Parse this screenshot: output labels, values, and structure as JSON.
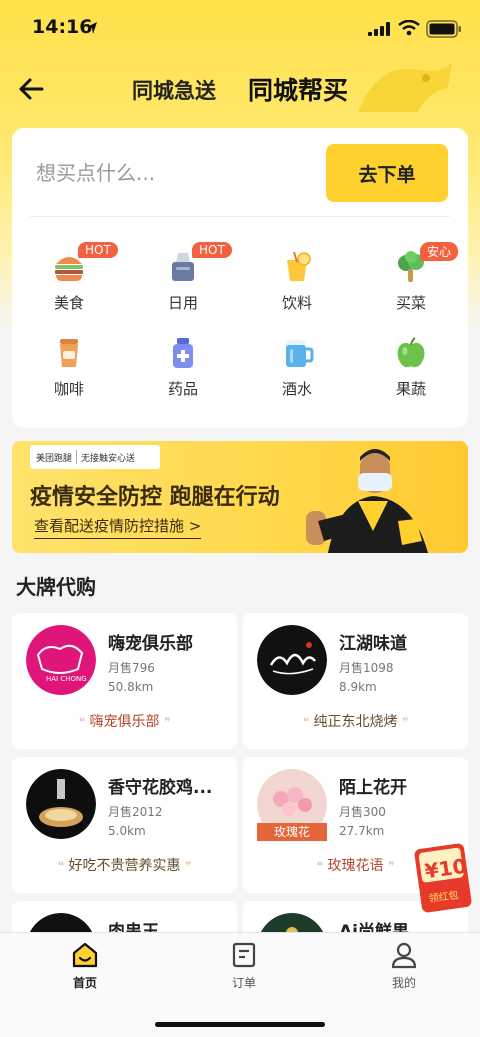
{
  "status_bar": {
    "time": "14:16"
  },
  "nav": {
    "tab_nearby": "同城急送",
    "tab_buy": "同城帮买"
  },
  "search": {
    "placeholder": "想买点什么...",
    "order_button": "去下单"
  },
  "categories": [
    {
      "label": "美食",
      "badge": "HOT",
      "icon": "burger-icon"
    },
    {
      "label": "日用",
      "badge": "HOT",
      "icon": "tissue-box-icon"
    },
    {
      "label": "饮料",
      "badge": "",
      "icon": "juice-icon"
    },
    {
      "label": "买菜",
      "badge": "安心",
      "icon": "vegetable-icon"
    },
    {
      "label": "咖啡",
      "badge": "",
      "icon": "coffee-cup-icon"
    },
    {
      "label": "药品",
      "badge": "",
      "icon": "medicine-bottle-icon"
    },
    {
      "label": "酒水",
      "badge": "",
      "icon": "beer-mug-icon"
    },
    {
      "label": "果蔬",
      "badge": "",
      "icon": "apple-icon"
    }
  ],
  "banner": {
    "logo_text": "美团跑腿",
    "logo_sub": "无接触安心送",
    "title": "疫情安全防控 跑腿在行动",
    "subtitle": "查看配送疫情防控措施 >"
  },
  "section_title": "大牌代购",
  "shops": [
    {
      "name": "嗨宠俱乐部",
      "sales": "月售796",
      "distance": "50.8km",
      "tag": "嗨宠俱乐部",
      "tag_style": "red",
      "logo_color": "#e0157a",
      "corner_tag": ""
    },
    {
      "name": "江湖味道",
      "sales": "月售1098",
      "distance": "8.9km",
      "tag": "纯正东北烧烤",
      "tag_style": "dark",
      "logo_color": "#111111",
      "corner_tag": ""
    },
    {
      "name": "香守花胶鸡...",
      "sales": "月售2012",
      "distance": "5.0km",
      "tag": "好吃不贵营养实惠",
      "tag_style": "dark",
      "logo_color": "#0e0e0e",
      "corner_tag": ""
    },
    {
      "name": "陌上花开",
      "sales": "月售300",
      "distance": "27.7km",
      "tag": "玫瑰花语",
      "tag_style": "red",
      "logo_color": "#f2d6d0",
      "corner_tag": "玫瑰花"
    },
    {
      "name": "肉串王",
      "sales": "",
      "distance": "",
      "tag": "",
      "tag_style": "dark",
      "logo_color": "#111111",
      "corner_tag": ""
    },
    {
      "name": "Ai尚鲜果",
      "sales": "",
      "distance": "",
      "tag": "",
      "tag_style": "dark",
      "logo_color": "#1f3b2a",
      "corner_tag": ""
    }
  ],
  "red_packet": {
    "amount": "¥10",
    "label": "领红包"
  },
  "tab_bar": {
    "home": "首页",
    "orders": "订单",
    "mine": "我的"
  }
}
